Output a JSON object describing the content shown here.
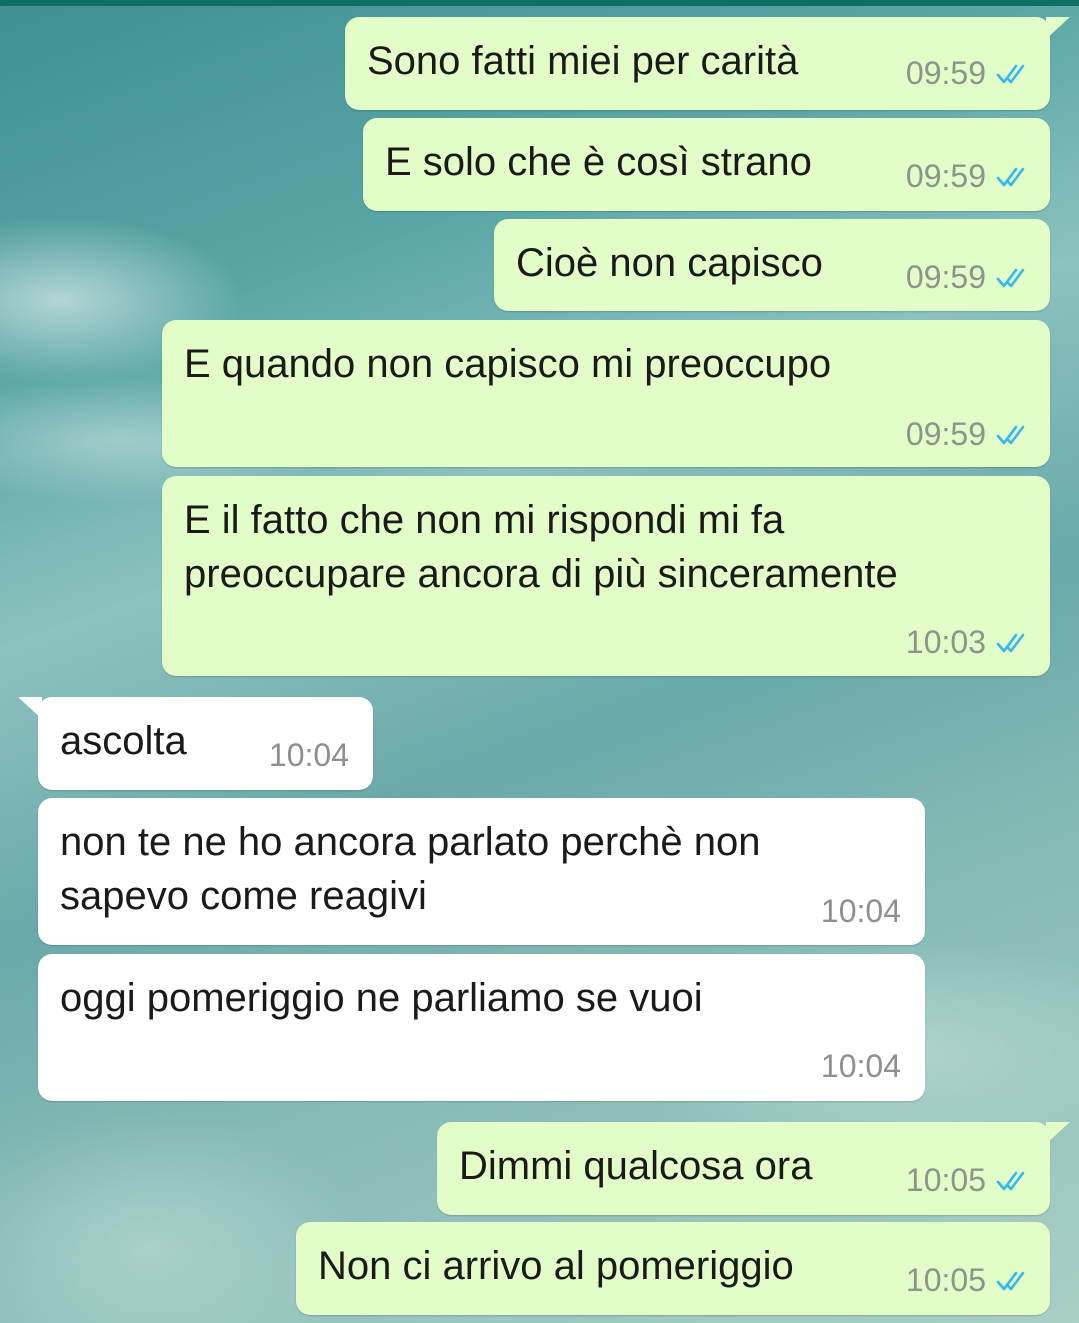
{
  "messages": [
    {
      "direction": "out",
      "text": "Sono fatti miei per carità",
      "time": "09:59",
      "status": "read"
    },
    {
      "direction": "out",
      "text": "E solo che è così strano",
      "time": "09:59",
      "status": "read"
    },
    {
      "direction": "out",
      "text": "Cioè non capisco",
      "time": "09:59",
      "status": "read"
    },
    {
      "direction": "out",
      "text": "E quando non capisco mi preoccupo",
      "time": "09:59",
      "status": "read"
    },
    {
      "direction": "out",
      "lines": [
        "E il fatto che non mi rispondi mi fa",
        "preoccupare ancora di più sinceramente"
      ],
      "time": "10:03",
      "status": "read"
    },
    {
      "direction": "in",
      "text": "ascolta",
      "time": "10:04"
    },
    {
      "direction": "in",
      "lines": [
        "non te ne ho ancora parlato perchè non",
        "sapevo come reagivi"
      ],
      "time": "10:04"
    },
    {
      "direction": "in",
      "text": "oggi pomeriggio ne parliamo se vuoi",
      "time": "10:04"
    },
    {
      "direction": "out",
      "text": "Dimmi qualcosa ora",
      "time": "10:05",
      "status": "read"
    },
    {
      "direction": "out",
      "text": "Non ci arrivo al pomeriggio",
      "time": "10:05",
      "status": "read"
    }
  ],
  "colors": {
    "outgoing_bubble": "#e2fdc8",
    "incoming_bubble": "#ffffff",
    "read_ticks": "#34b7f1",
    "timestamp": "#8c958c"
  },
  "icons": {
    "read_status": "double-check-icon"
  }
}
